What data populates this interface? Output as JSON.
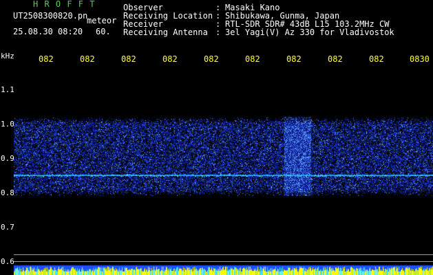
{
  "header": {
    "brand": "H R O F F T",
    "filename": "UT2508300820.pn",
    "mode": "meteor",
    "timestamp": "25.08.30 08:20",
    "interval": "60."
  },
  "info": [
    {
      "label": "Observer",
      "value": "Masaki Kano"
    },
    {
      "label": "Receiving Location",
      "value": "Shibukawa, Gunma, Japan"
    },
    {
      "label": "Receiver",
      "value": "RTL-SDR SDR# 43dB L15 103.2MHz CW"
    },
    {
      "label": "Receiving Antenna",
      "value": "3el Yagi(V) Az 330 for Vladivostok"
    }
  ],
  "info_separator": ":",
  "axis": {
    "y_unit": "kHz",
    "y_ticks": [
      "1.1",
      "1.0",
      "0.9",
      "0.8",
      "0.7",
      "0.6"
    ],
    "x_ticks": [
      "082",
      "082",
      "082",
      "082",
      "082",
      "082",
      "082",
      "082",
      "082",
      "0830"
    ]
  },
  "colors": {
    "header_green": "#4ad24a",
    "text_white": "#ffffff",
    "tick_yellow": "#ffff33",
    "spectrum_blue": "#1a3cff",
    "signal_cyan": "#40e0ff",
    "bar_yellow": "#ffff00"
  }
}
